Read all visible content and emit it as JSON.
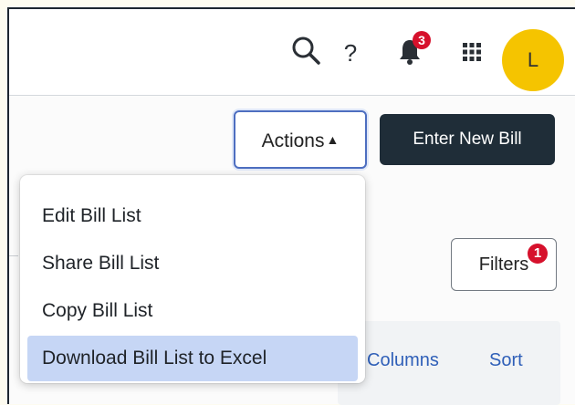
{
  "header": {
    "help_glyph": "?",
    "notifications_count": "3",
    "avatar_initial": "L",
    "icons": [
      "search-icon",
      "help-icon",
      "bell-icon",
      "apps-grid-icon"
    ]
  },
  "toolbar": {
    "actions_label": "Actions",
    "actions_caret": "▲",
    "enter_new_bill_label": "Enter New Bill",
    "filters_label": "Filters",
    "filters_count": "1"
  },
  "actions_menu": {
    "items": [
      {
        "label": "Edit Bill List"
      },
      {
        "label": "Share Bill List"
      },
      {
        "label": "Copy Bill List"
      },
      {
        "label": "Download Bill List to Excel",
        "highlighted": true
      }
    ]
  },
  "list_header": {
    "columns_label": "Columns",
    "sort_label": "Sort"
  },
  "colors": {
    "primary_dark": "#1f2d38",
    "link": "#2f5fb8",
    "badge_red": "#d6112c",
    "avatar_yellow": "#f5c400",
    "menu_highlight": "#c6d6f5",
    "focus_border": "#4d6ec0"
  }
}
